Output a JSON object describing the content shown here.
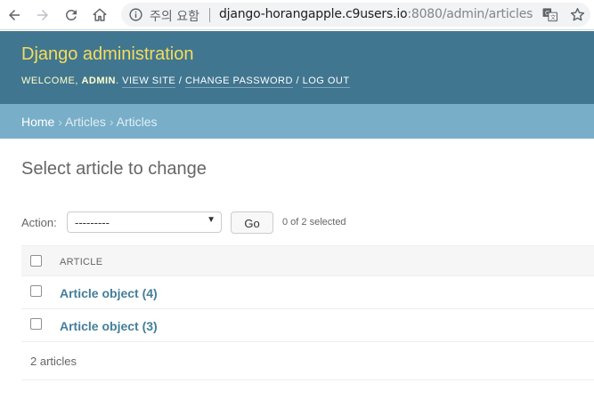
{
  "browser": {
    "security_warning": "주의 요함",
    "url_host": "django-horangapple.c9users.io",
    "url_rest": ":8080/admin/articles/a..."
  },
  "header": {
    "branding": "Django administration",
    "welcome": "WELCOME, ",
    "username": "ADMIN",
    "view_site": "VIEW SITE",
    "change_password": "CHANGE PASSWORD",
    "log_out": "LOG OUT",
    "slash": " / "
  },
  "breadcrumbs": {
    "home": "Home",
    "app": "Articles",
    "model": "Articles",
    "sep": " › "
  },
  "content": {
    "title": "Select article to change"
  },
  "actions": {
    "label": "Action:",
    "selected_option": "---------",
    "go": "Go",
    "selected_count": "0 of 2 selected"
  },
  "table": {
    "column": "ARTICLE",
    "rows": [
      {
        "label": "Article object (4)"
      },
      {
        "label": "Article object (3)"
      }
    ]
  },
  "paginator": {
    "text": "2 articles"
  }
}
